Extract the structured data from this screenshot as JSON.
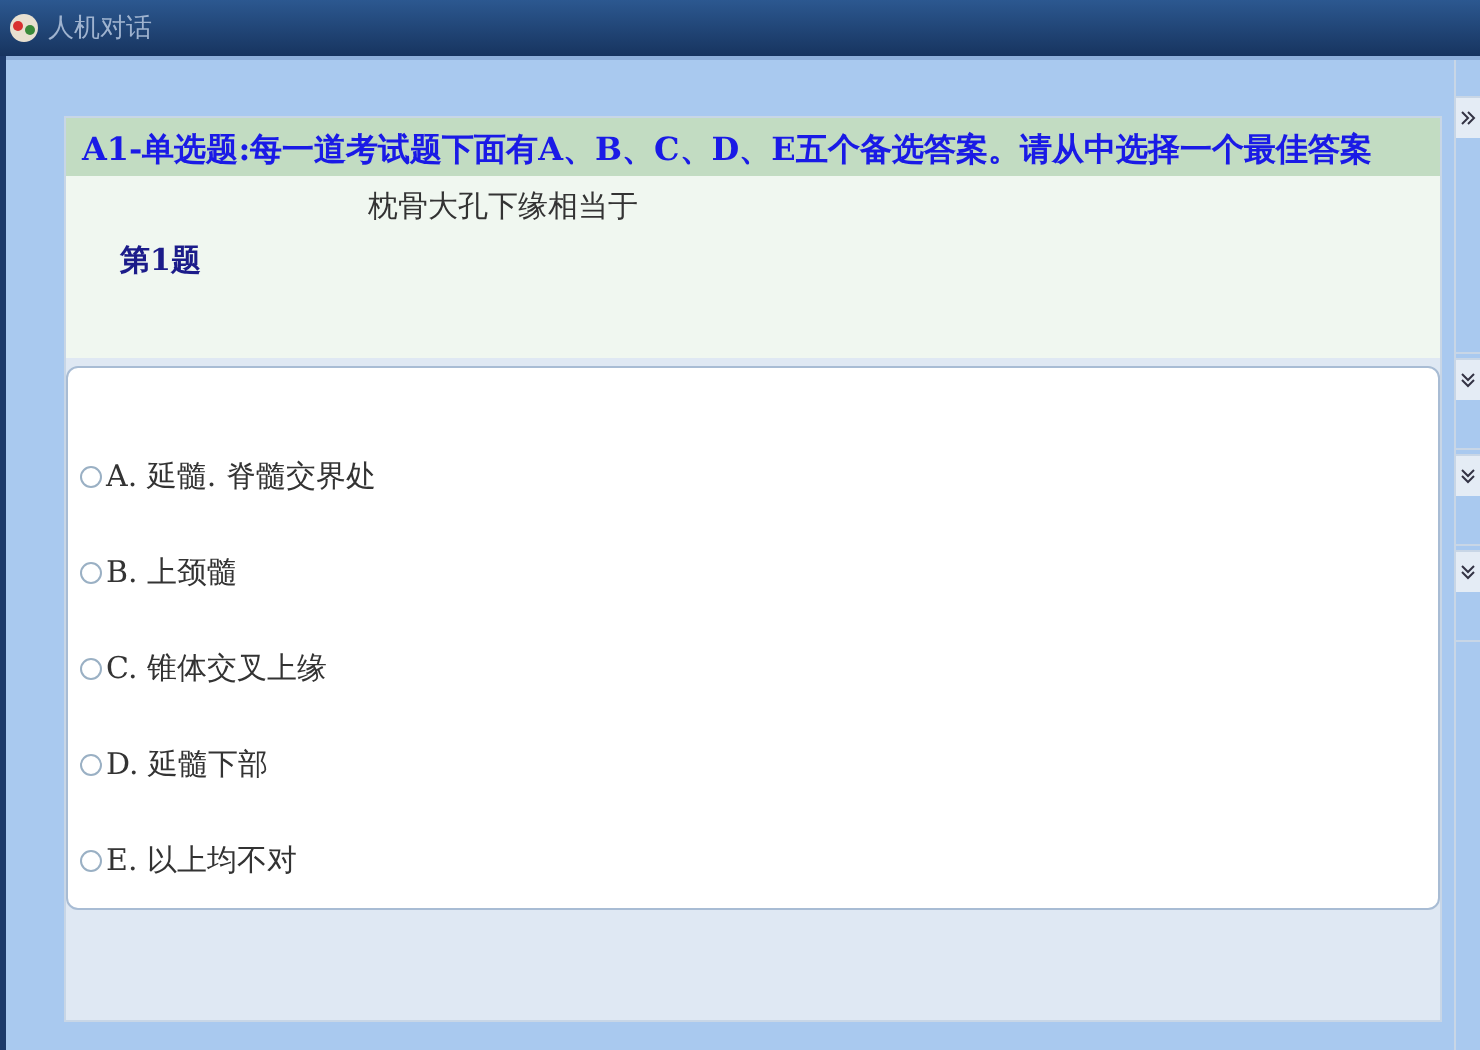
{
  "window": {
    "title": "人机对话"
  },
  "section": {
    "heading": "A1-单选题:每一道考试题下面有A、B、C、D、E五个备选答案。请从中选择一个最佳答案"
  },
  "question": {
    "text": "枕骨大孔下缘相当于",
    "number": "第1题"
  },
  "options": [
    {
      "label": "A. 延髓. 脊髓交界处",
      "selected": false
    },
    {
      "label": "B. 上颈髓",
      "selected": false
    },
    {
      "label": "C. 锥体交叉上缘",
      "selected": false
    },
    {
      "label": "D. 延髓下部",
      "selected": false
    },
    {
      "label": "E. 以上均不对",
      "selected": false
    }
  ],
  "side_panels": [
    {
      "expanded": true
    },
    {
      "expanded": false
    },
    {
      "expanded": false
    },
    {
      "expanded": false
    }
  ]
}
